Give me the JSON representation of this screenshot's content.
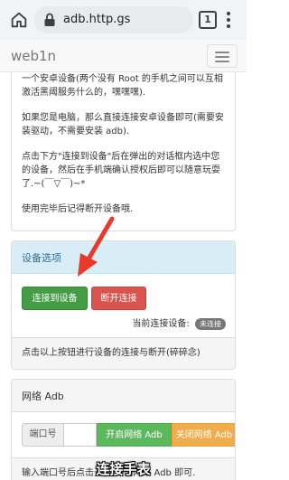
{
  "browser": {
    "url": "adb.http.gs",
    "tab_count": "1"
  },
  "navbar": {
    "brand": "web1n"
  },
  "instructions": {
    "paragraphs": [
      "如果您是手机，那么可以使用 adb 无线调试连接另一个安卓设备(两个没有 Root 的手机之间可以互相激活黑阈服务什么的，嘿嘿嘿).",
      "如果您是电脑，那么直接连接安卓设备即可(需要安装驱动，不需要安装 adb).",
      "点击下方\"连接到设备\"后在弹出的对话框内选中您的设备，然后在手机端确认授权后即可以随意玩耍了.~(￣▽￣)~*",
      "使用完毕后记得断开设备哦."
    ]
  },
  "device_panel": {
    "title": "设备选项",
    "connect_label": "连接到设备",
    "disconnect_label": "断开连接",
    "status_prefix": "当前连接设备:",
    "status_value": "未连接",
    "footer": "点击以上按钮进行设备的连接与断开(碎碎念)"
  },
  "network_panel": {
    "title": "网络 Adb",
    "port_label": "端口号",
    "port_value": "",
    "open_label": "开启网络 Adb",
    "close_label": "关闭网络 Adb",
    "footer": "输入端口号后点击开启/关闭网络 Adb 即可."
  },
  "overlay": {
    "subtitle": "连接手表"
  },
  "colors": {
    "success": "#449d44",
    "danger": "#d9534f",
    "warning": "#f0ad4e",
    "info_bg": "#d9edf7",
    "arrow": "#e8392b"
  }
}
